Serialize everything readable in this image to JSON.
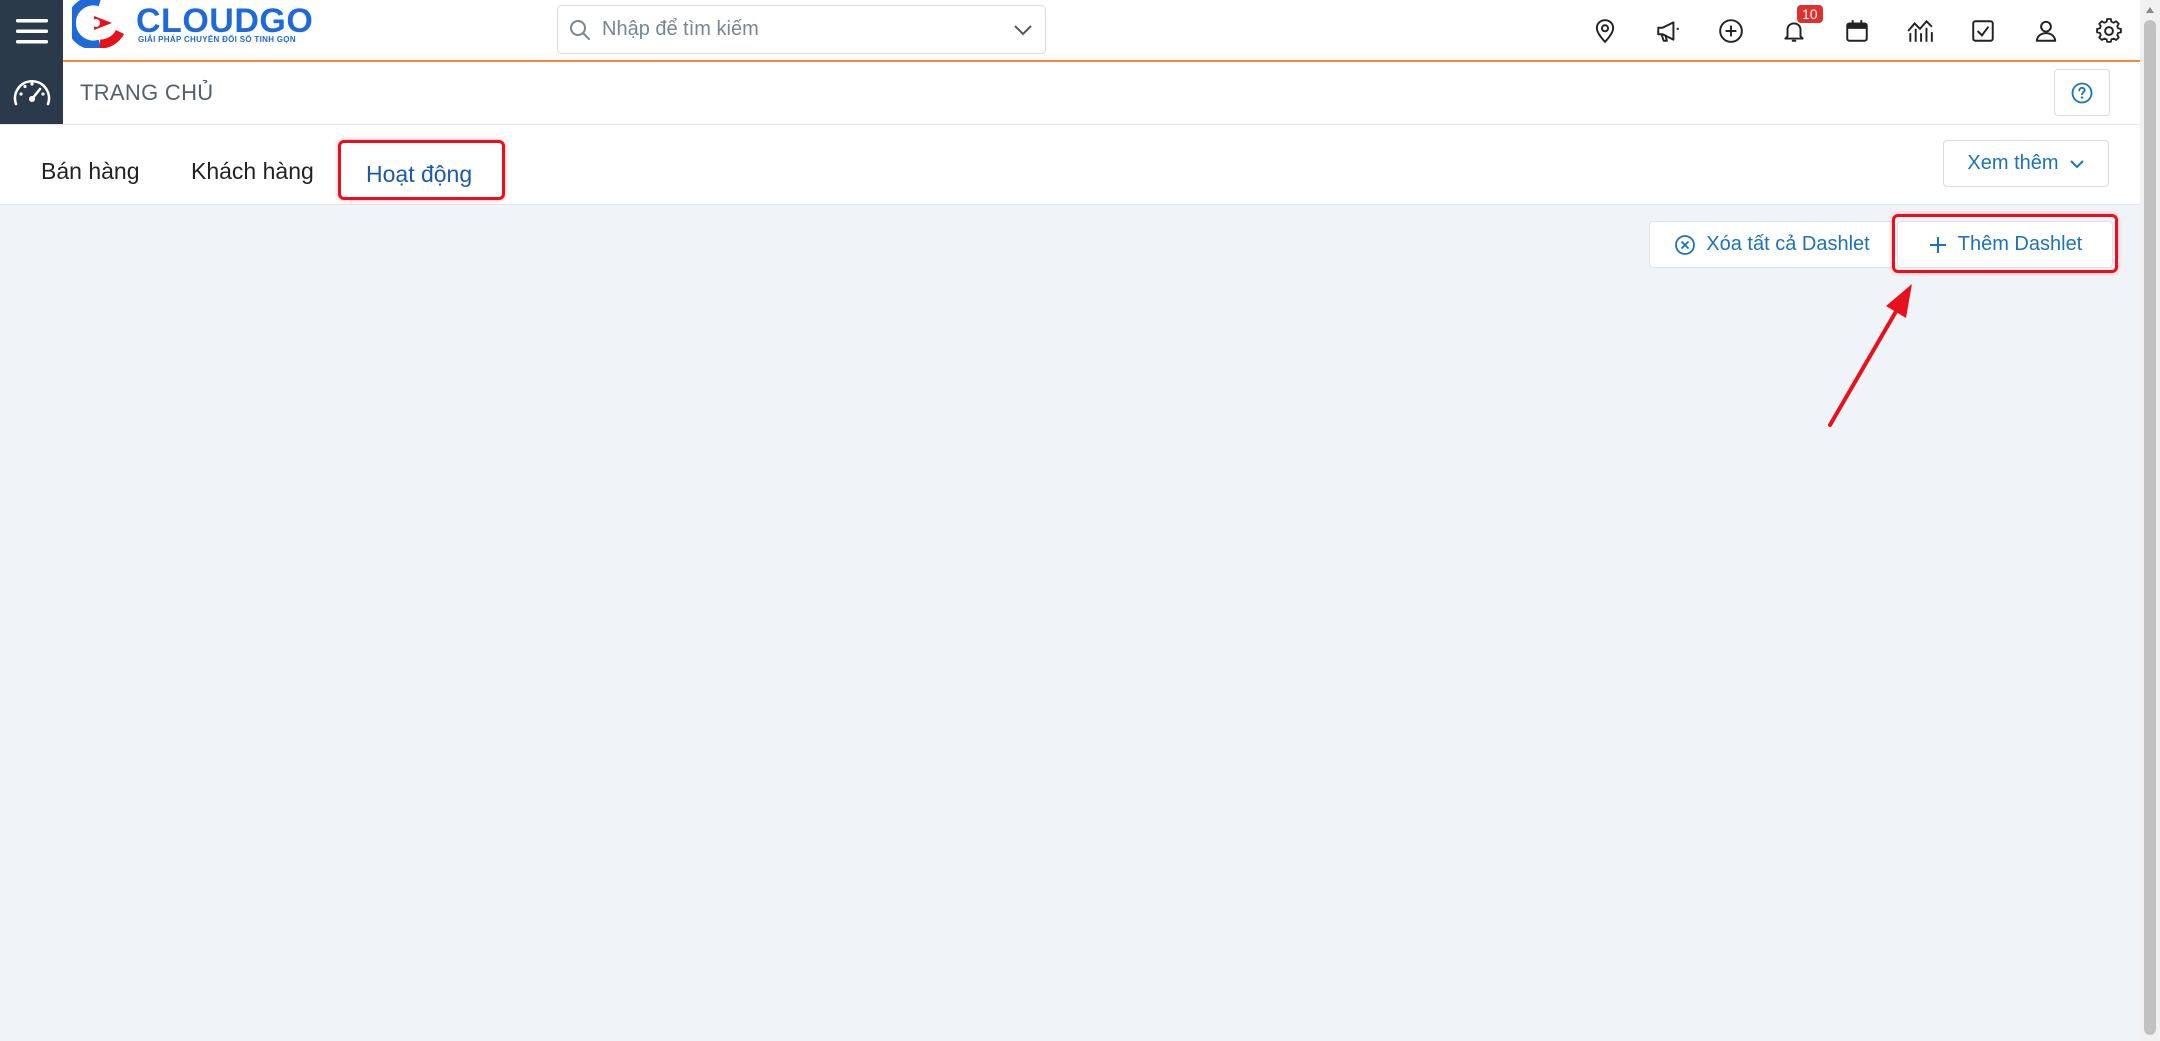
{
  "brand": {
    "name": "CLOUDGO",
    "tagline": "GIẢI PHÁP CHUYỂN ĐỔI SỐ TINH GỌN",
    "primary_color": "#1e6ad8",
    "accent_color": "#e8101c"
  },
  "search": {
    "placeholder": "Nhập để tìm kiếm",
    "value": ""
  },
  "toolbar": {
    "icons": [
      "location-icon",
      "megaphone-icon",
      "plus-circle-icon",
      "bell-icon",
      "calendar-icon",
      "chart-icon",
      "checkbox-icon",
      "user-icon",
      "gear-icon"
    ],
    "notification_count": "10"
  },
  "page": {
    "title": "TRANG CHỦ"
  },
  "tabs": [
    {
      "label": "Bán hàng",
      "active": false
    },
    {
      "label": "Khách hàng",
      "active": false
    },
    {
      "label": "Hoạt động",
      "active": true
    }
  ],
  "more_button": {
    "label": "Xem thêm"
  },
  "actions": {
    "clear_label": "Xóa tất cả Dashlet",
    "add_label": "Thêm Dashlet"
  },
  "colors": {
    "header_dark": "#2b3a4a",
    "link_blue": "#1a73b8",
    "active_tab": "#1a5aa8",
    "header_border": "#f08a3c",
    "background": "#f0f4f8",
    "badge": "#e03131"
  }
}
